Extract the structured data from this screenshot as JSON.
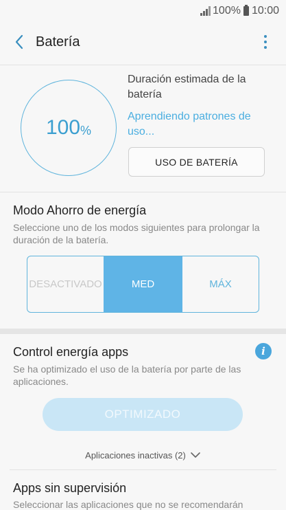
{
  "status_bar": {
    "battery_percent": "100%",
    "time": "10:00",
    "signal_icon": "signal-icon",
    "battery_icon": "battery-icon"
  },
  "app_bar": {
    "title": "Batería",
    "back_icon": "back-arrow-icon",
    "more_icon": "more-vert-icon"
  },
  "battery": {
    "percent_value": "100",
    "percent_symbol": "%",
    "percent_fill": 1.0,
    "estimate_title": "Duración estimada de la batería",
    "learning_text": "Aprendiendo patrones de uso...",
    "usage_button": "USO DE BATERÍA"
  },
  "power_saving": {
    "title": "Modo Ahorro de energía",
    "subtitle": "Seleccione uno de los modos siguientes para prolongar la duración de la batería.",
    "modes": [
      "DESACTIVADO",
      "MED",
      "MÁX"
    ],
    "selected": "MED"
  },
  "app_power": {
    "title": "Control energía apps",
    "subtitle": "Se ha optimizado el uso de la batería por parte de las aplicaciones.",
    "button": "OPTIMIZADO",
    "inactive_label": "Aplicaciones inactivas (2)",
    "info_icon": "info-icon"
  },
  "unmonitored": {
    "title": "Apps sin supervisión",
    "subtitle": "Seleccionar las aplicaciones que no se recomendarán"
  },
  "colors": {
    "accent": "#5fb4dc",
    "accent_fill": "#5fb4e6",
    "button_disabled": "#c9e6f6"
  }
}
